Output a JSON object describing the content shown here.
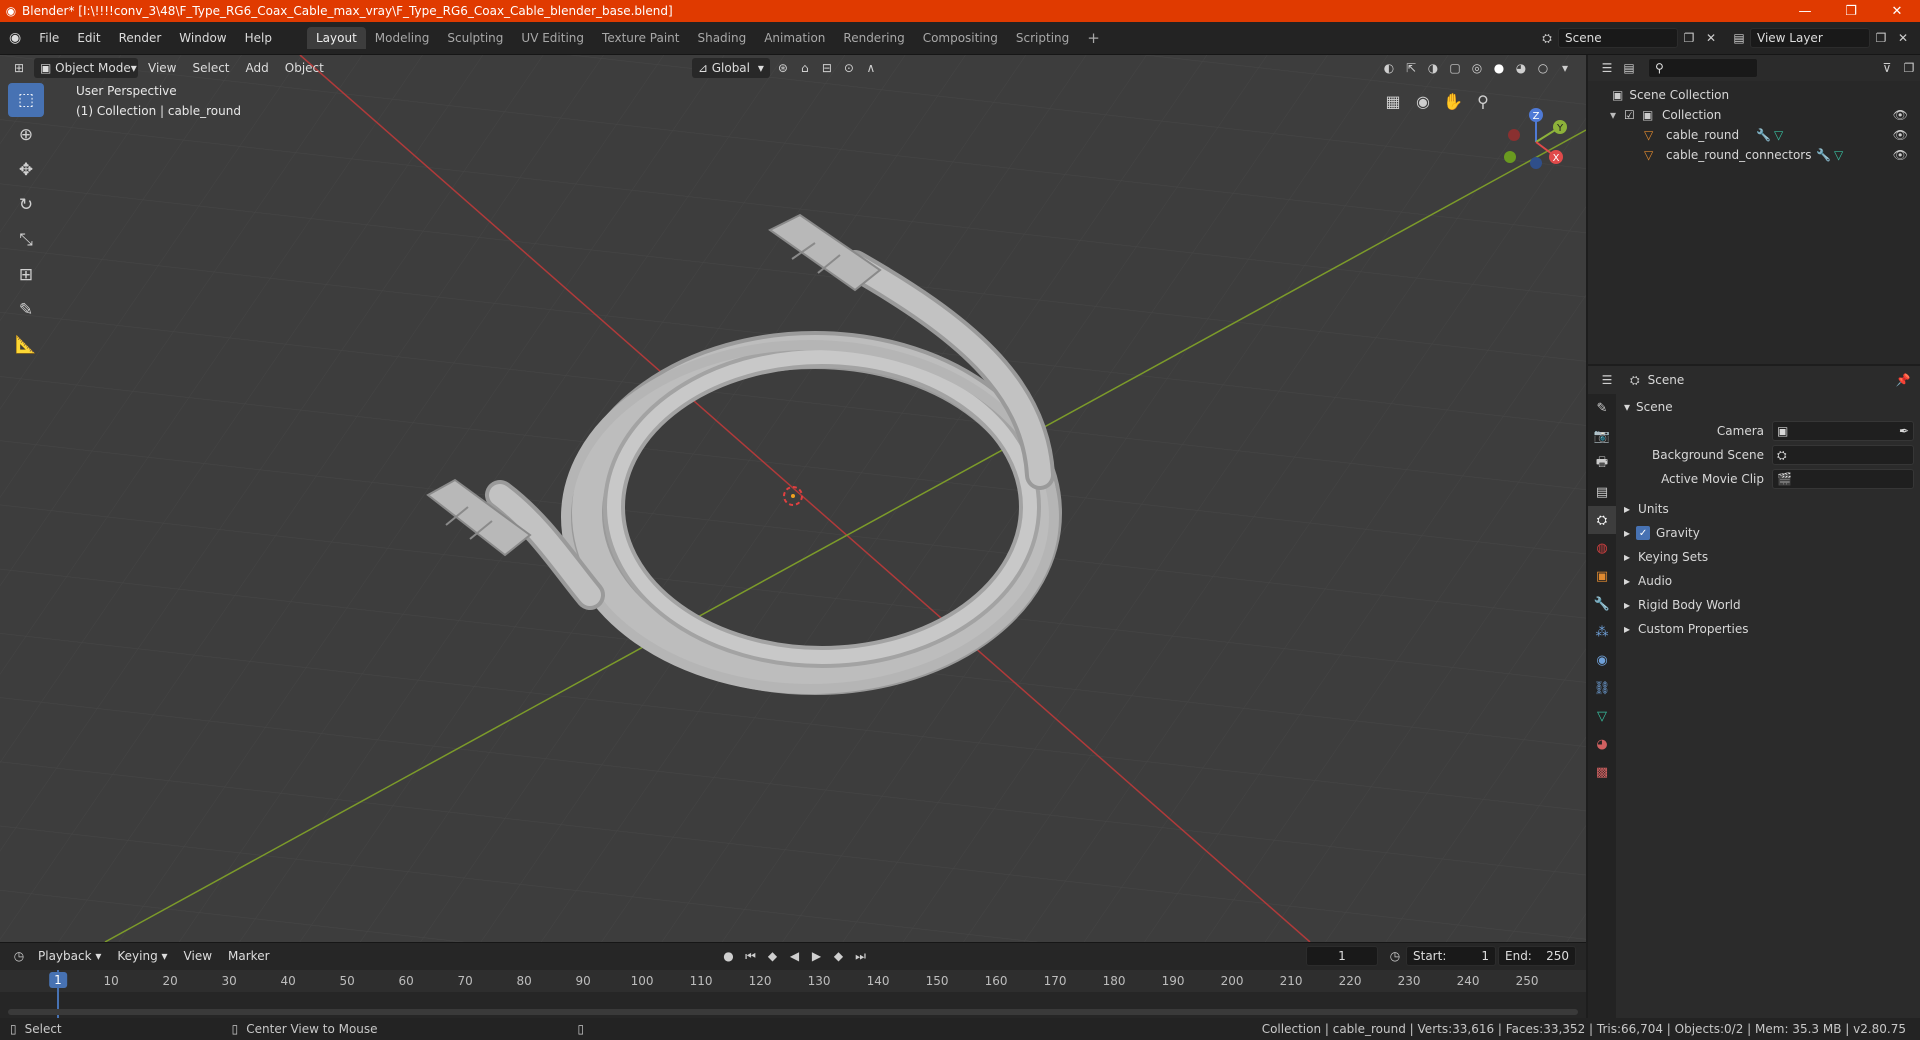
{
  "window": {
    "title": "Blender* [I:\\!!!!conv_3\\48\\F_Type_RG6_Coax_Cable_max_vray\\F_Type_RG6_Coax_Cable_blender_base.blend]",
    "minimize": "—",
    "maximize": "❐",
    "close": "✕"
  },
  "menu": {
    "file": "File",
    "edit": "Edit",
    "render": "Render",
    "window": "Window",
    "help": "Help"
  },
  "workspaces": [
    "Layout",
    "Modeling",
    "Sculpting",
    "UV Editing",
    "Texture Paint",
    "Shading",
    "Animation",
    "Rendering",
    "Compositing",
    "Scripting"
  ],
  "scene_selector": {
    "value": "Scene"
  },
  "view_layer_selector": {
    "value": "View Layer"
  },
  "viewport": {
    "mode": "Object Mode",
    "menus": [
      "View",
      "Select",
      "Add",
      "Object"
    ],
    "transform_orientation": "Global",
    "overlay_line1": "User Perspective",
    "overlay_line2": "(1) Collection | cable_round",
    "gizmo": {
      "x": "X",
      "y": "Y",
      "z": "Z"
    }
  },
  "outliner": {
    "root": "Scene Collection",
    "collection": "Collection",
    "objects": [
      "cable_round",
      "cable_round_connectors"
    ]
  },
  "properties": {
    "context": "Scene",
    "panel": "Scene",
    "camera_label": "Camera",
    "background_scene_label": "Background Scene",
    "active_movie_clip_label": "Active Movie Clip",
    "sections": [
      "Units",
      "Gravity",
      "Keying Sets",
      "Audio",
      "Rigid Body World",
      "Custom Properties"
    ],
    "gravity_enabled": true
  },
  "timeline": {
    "menus": [
      "Playback",
      "Keying",
      "View",
      "Marker"
    ],
    "current_frame": "1",
    "start_label": "Start:",
    "start": "1",
    "end_label": "End:",
    "end": "250",
    "ruler": [
      "1",
      "10",
      "20",
      "30",
      "40",
      "50",
      "60",
      "70",
      "80",
      "90",
      "100",
      "110",
      "120",
      "130",
      "140",
      "150",
      "160",
      "170",
      "180",
      "190",
      "200",
      "210",
      "220",
      "230",
      "240",
      "250"
    ]
  },
  "status": {
    "left_action": "Select",
    "middle_action": "Center View to Mouse",
    "stats": "Collection | cable_round | Verts:33,616 | Faces:33,352 | Tris:66,704 | Objects:0/2 | Mem: 35.3 MB | v2.80.75"
  },
  "colors": {
    "title_bar": "#e03a00",
    "accent_blue": "#4772b3",
    "axis_x": "#c23a3a",
    "axis_y": "#7a9a2a",
    "viewport_bg": "#3d3d3d"
  }
}
